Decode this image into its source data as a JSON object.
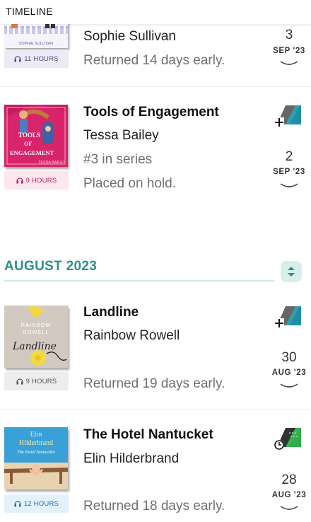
{
  "header": {
    "title": "TIMELINE"
  },
  "colors": {
    "accent": "#2f8f84",
    "month_line": "#cfe8e4"
  },
  "september_entries": [
    {
      "author": "Sophie Sullivan",
      "cover_credit": "SOPHIE SULLIVAN",
      "badge": "11 HOURS",
      "note": "Returned 14 days early.",
      "day": "3",
      "month": "SEP '23",
      "icon": "chevron-down-icon"
    },
    {
      "title": "Tools of Engagement",
      "author": "Tessa Bailey",
      "series": "#3 in series",
      "note": "Placed on hold.",
      "badge": "9 HOURS",
      "day": "2",
      "month": "SEP '23",
      "cover_text": [
        "TOOLS",
        "OF",
        "ENGAGEMENT",
        "TESSA BAILEY"
      ],
      "status_icon": "add-to-shelf-icon"
    }
  ],
  "month_header": {
    "label": "AUGUST 2023",
    "icon": "expand-collapse-icon"
  },
  "august_entries": [
    {
      "title": "Landline",
      "author": "Rainbow Rowell",
      "note": "Returned 19 days early.",
      "badge": "9 HOURS",
      "day": "30",
      "month": "AUG '23",
      "cover_text": [
        "RAINBOW",
        "ROWELL",
        "Landline"
      ],
      "status_icon": "add-to-shelf-icon"
    },
    {
      "title": "The Hotel Nantucket",
      "author": "Elin Hilderbrand",
      "note": "Returned 18 days early.",
      "badge": "12 HOURS",
      "day": "28",
      "month": "AUG '23",
      "cover_text": [
        "Elin",
        "Hilderbrand",
        "The Hotel Nantucket"
      ],
      "status_icon": "borrowed-clock-icon"
    }
  ]
}
